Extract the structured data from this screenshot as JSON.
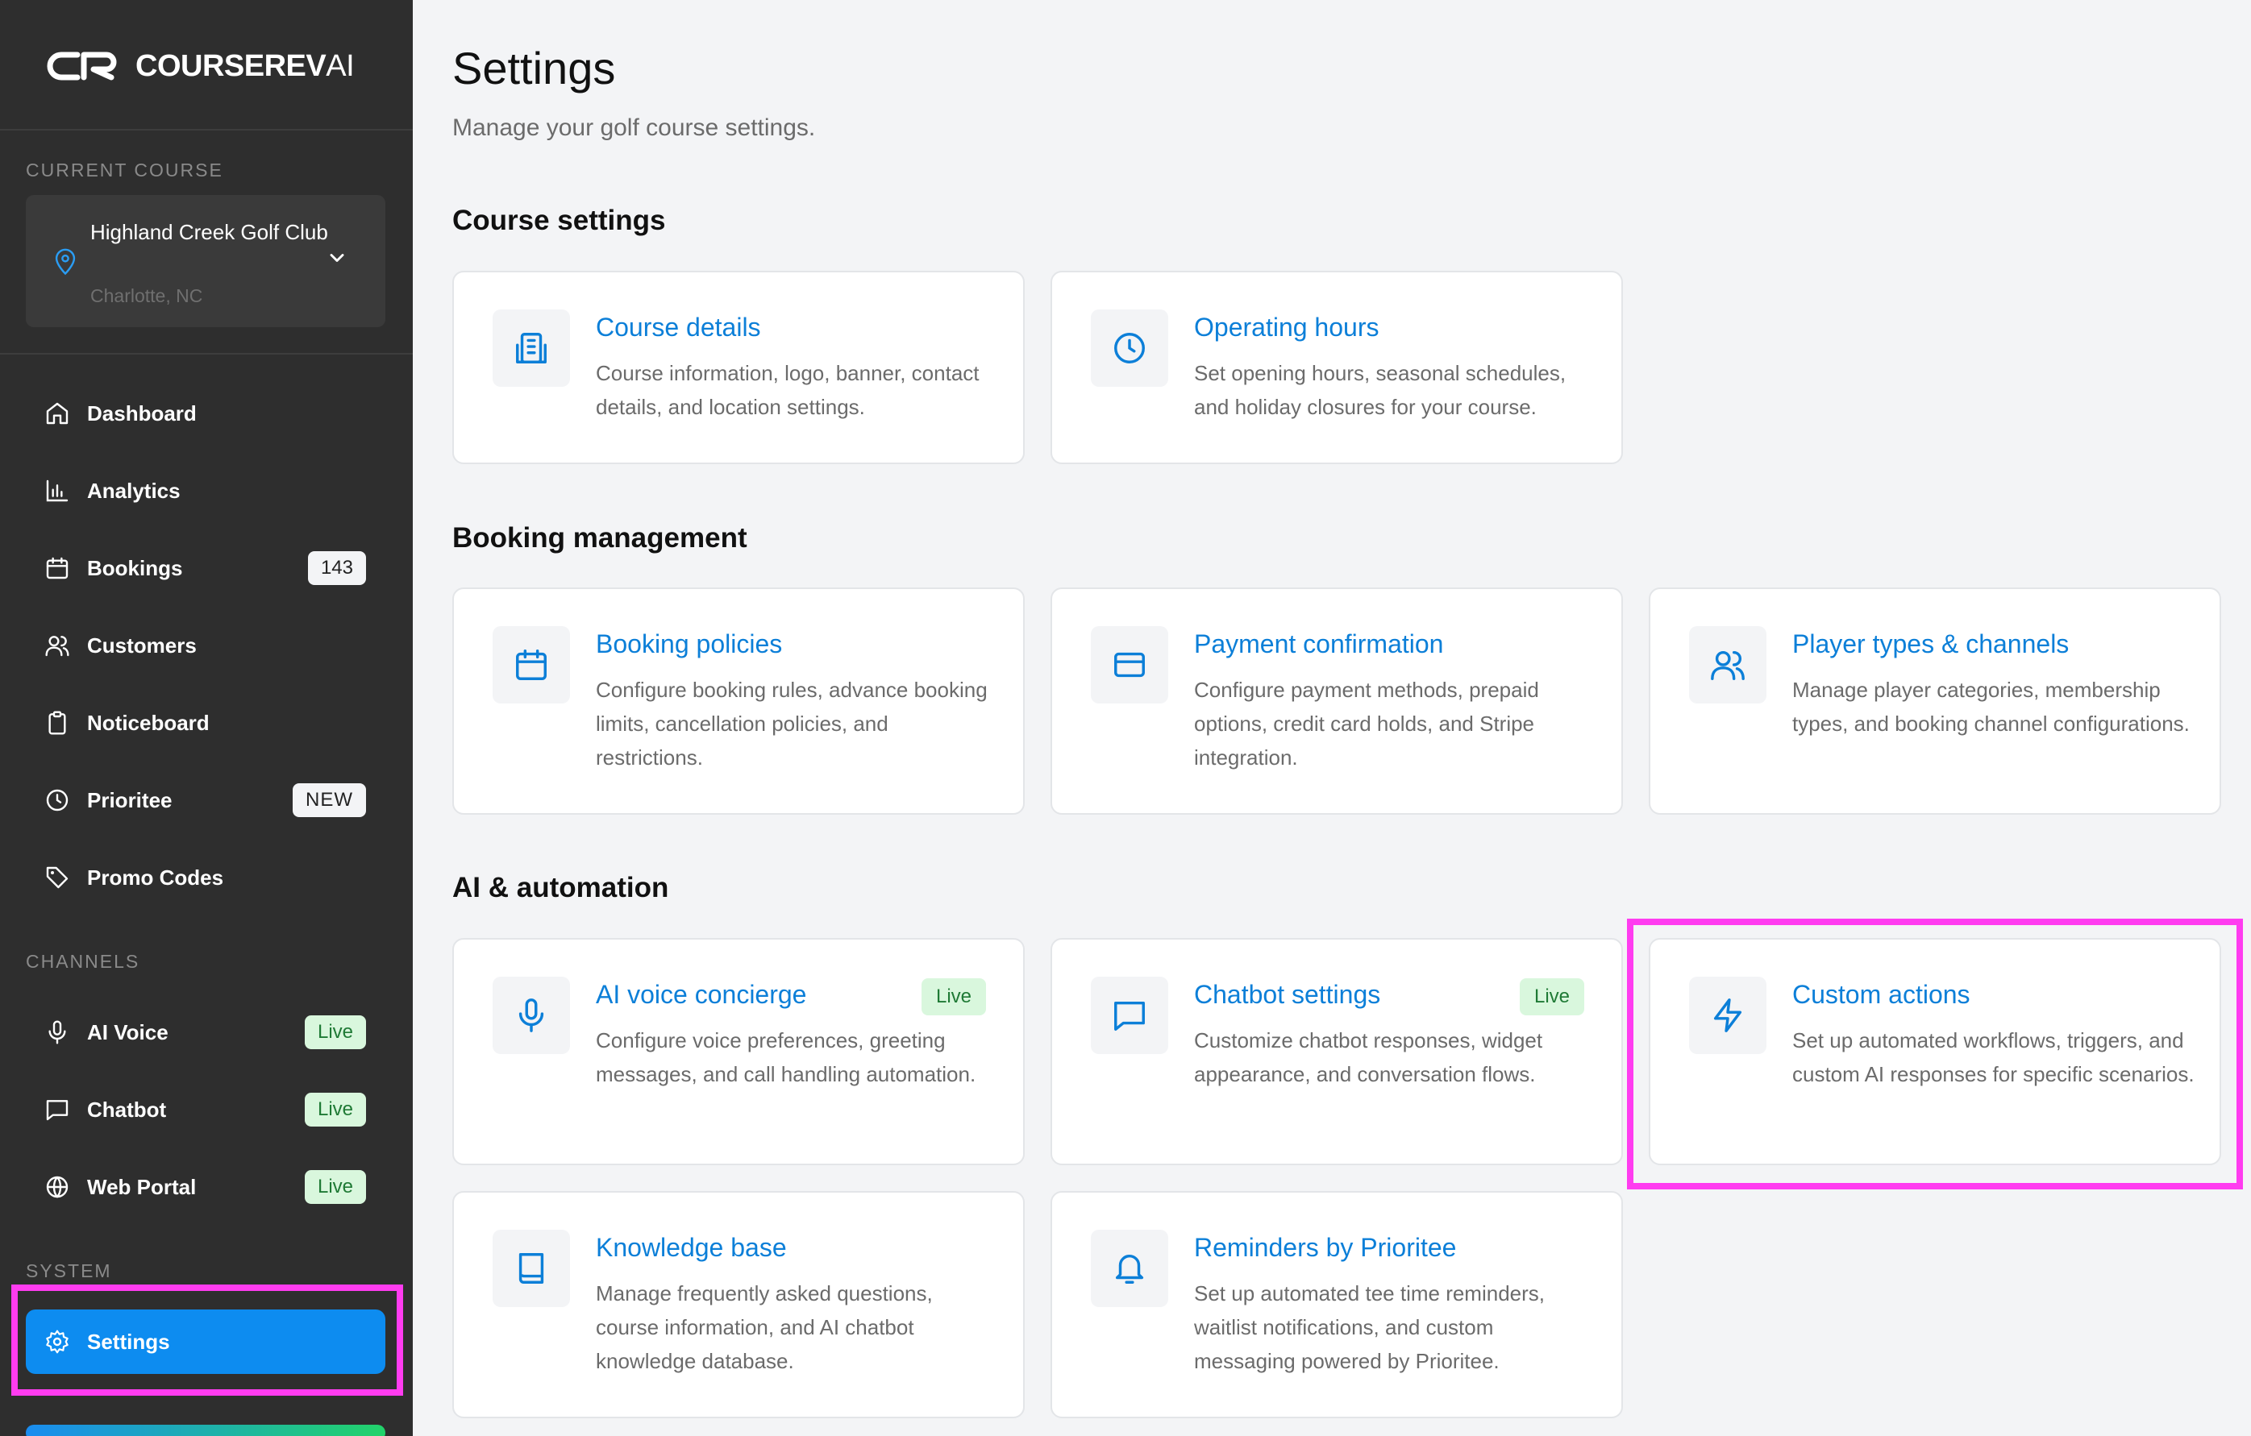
{
  "brand": {
    "name": "COURSEREV",
    "suffix": "AI"
  },
  "sidebar": {
    "current_course_label": "CURRENT COURSE",
    "course": {
      "name": "Highland Creek Golf Club",
      "location": "Charlotte, NC"
    },
    "nav": [
      {
        "label": "Dashboard",
        "icon": "home-icon"
      },
      {
        "label": "Analytics",
        "icon": "bar-chart-icon"
      },
      {
        "label": "Bookings",
        "icon": "calendar-icon",
        "badge": "143"
      },
      {
        "label": "Customers",
        "icon": "users-icon"
      },
      {
        "label": "Noticeboard",
        "icon": "clipboard-icon"
      },
      {
        "label": "Prioritee",
        "icon": "clock-icon",
        "badge": "NEW"
      },
      {
        "label": "Promo Codes",
        "icon": "tag-icon"
      }
    ],
    "channels_label": "CHANNELS",
    "channels": [
      {
        "label": "AI Voice",
        "icon": "microphone-icon",
        "badge": "Live"
      },
      {
        "label": "Chatbot",
        "icon": "chat-icon",
        "badge": "Live"
      },
      {
        "label": "Web Portal",
        "icon": "globe-icon",
        "badge": "Live"
      }
    ],
    "system_label": "SYSTEM",
    "settings_label": "Settings"
  },
  "main": {
    "title": "Settings",
    "subtitle": "Manage your golf course settings.",
    "sections": [
      {
        "title": "Course settings",
        "cards": [
          {
            "title": "Course details",
            "desc": "Course information, logo, banner, contact details, and location settings.",
            "icon": "building-icon"
          },
          {
            "title": "Operating hours",
            "desc": "Set opening hours, seasonal schedules, and holiday closures for your course.",
            "icon": "clock-icon"
          }
        ]
      },
      {
        "title": "Booking management",
        "cards": [
          {
            "title": "Booking policies",
            "desc": "Configure booking rules, advance booking limits, cancellation policies, and restrictions.",
            "icon": "calendar-icon"
          },
          {
            "title": "Payment confirmation",
            "desc": "Configure payment methods, prepaid options, credit card holds, and Stripe integration.",
            "icon": "credit-card-icon"
          },
          {
            "title": "Player types & channels",
            "desc": "Manage player categories, membership types, and booking channel configurations.",
            "icon": "users-icon"
          }
        ]
      },
      {
        "title": "AI & automation",
        "cards": [
          {
            "title": "AI voice concierge",
            "desc": "Configure voice preferences, greeting messages, and call handling automation.",
            "icon": "microphone-icon",
            "badge": "Live"
          },
          {
            "title": "Chatbot settings",
            "desc": "Customize chatbot responses, widget appearance, and conversation flows.",
            "icon": "chat-icon",
            "badge": "Live"
          },
          {
            "title": "Custom actions",
            "desc": "Set up automated workflows, triggers, and custom AI responses for specific scenarios.",
            "icon": "lightning-icon"
          },
          {
            "title": "Knowledge base",
            "desc": "Manage frequently asked questions, course information, and AI chatbot knowledge database.",
            "icon": "book-icon"
          },
          {
            "title": "Reminders by Prioritee",
            "desc": "Set up automated tee time reminders, waitlist notifications, and custom messaging powered by Prioritee.",
            "icon": "bell-icon"
          }
        ]
      }
    ]
  },
  "colors": {
    "accent": "#0d8cf0",
    "link": "#0c7fd8",
    "highlight": "#ff3cf0",
    "sidebar_bg": "#2e2e2e",
    "live_bg": "#d9f7dd",
    "live_text": "#1f7a35"
  }
}
